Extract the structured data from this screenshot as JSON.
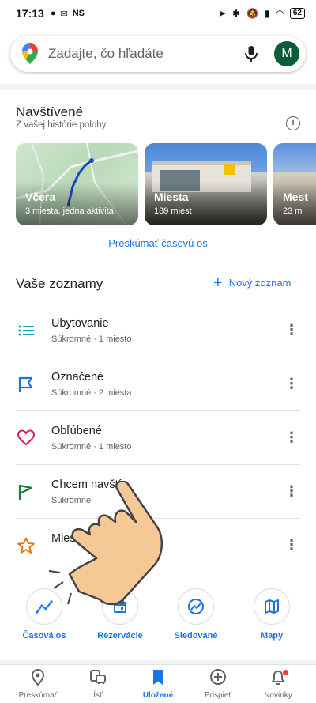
{
  "status_bar": {
    "time": "17:13",
    "ns": "NS",
    "battery": "62"
  },
  "search": {
    "placeholder": "Zadajte, čo hľadáte",
    "avatar_letter": "M"
  },
  "visited": {
    "title": "Navštívené",
    "subtitle": "Z vašej histórie polohy",
    "cards": [
      {
        "title": "Včera",
        "sub": "3 miesta, jedna aktivita"
      },
      {
        "title": "Miesta",
        "sub": "189 miest"
      },
      {
        "title": "Mest",
        "sub": "23 m"
      }
    ],
    "explore_link": "Preskúmať časovú os"
  },
  "lists": {
    "title": "Vaše zoznamy",
    "new_list": "Nový zoznam",
    "items": [
      {
        "title": "Ubytovanie",
        "sub": "Súkromné · 1 miesto",
        "icon": "list-icon",
        "color": "#12a5b5"
      },
      {
        "title": "Označené",
        "sub": "Súkromné · 2 miesta",
        "icon": "flag-outline-icon",
        "color": "#1a73e8"
      },
      {
        "title": "Obľúbené",
        "sub": "Súkromné · 1 miesto",
        "icon": "heart-icon",
        "color": "#d81b60"
      },
      {
        "title": "Chcem navští",
        "sub": "Súkromné",
        "icon": "green-flag-icon",
        "color": "#188038"
      },
      {
        "title": "Miesta",
        "sub": "",
        "title_tail": "ou",
        "icon": "star-icon",
        "color": "#e8710a"
      }
    ]
  },
  "quick_actions": [
    {
      "label": "Časová os",
      "icon": "timeline-icon"
    },
    {
      "label": "Rezervácie",
      "icon": "calendar-icon"
    },
    {
      "label": "Sledované",
      "icon": "followed-icon"
    },
    {
      "label": "Mapy",
      "icon": "map-icon"
    }
  ],
  "bottom_nav": [
    {
      "label": "Preskúmať",
      "icon": "location-pin-icon"
    },
    {
      "label": "Ísť",
      "icon": "commute-icon"
    },
    {
      "label": "Uložené",
      "icon": "bookmark-icon",
      "active": true
    },
    {
      "label": "Prispieť",
      "icon": "add-circle-icon"
    },
    {
      "label": "Novinky",
      "icon": "bell-icon"
    }
  ],
  "colors": {
    "accent": "#1a73e8",
    "avatar_bg": "#0b5d3a"
  }
}
